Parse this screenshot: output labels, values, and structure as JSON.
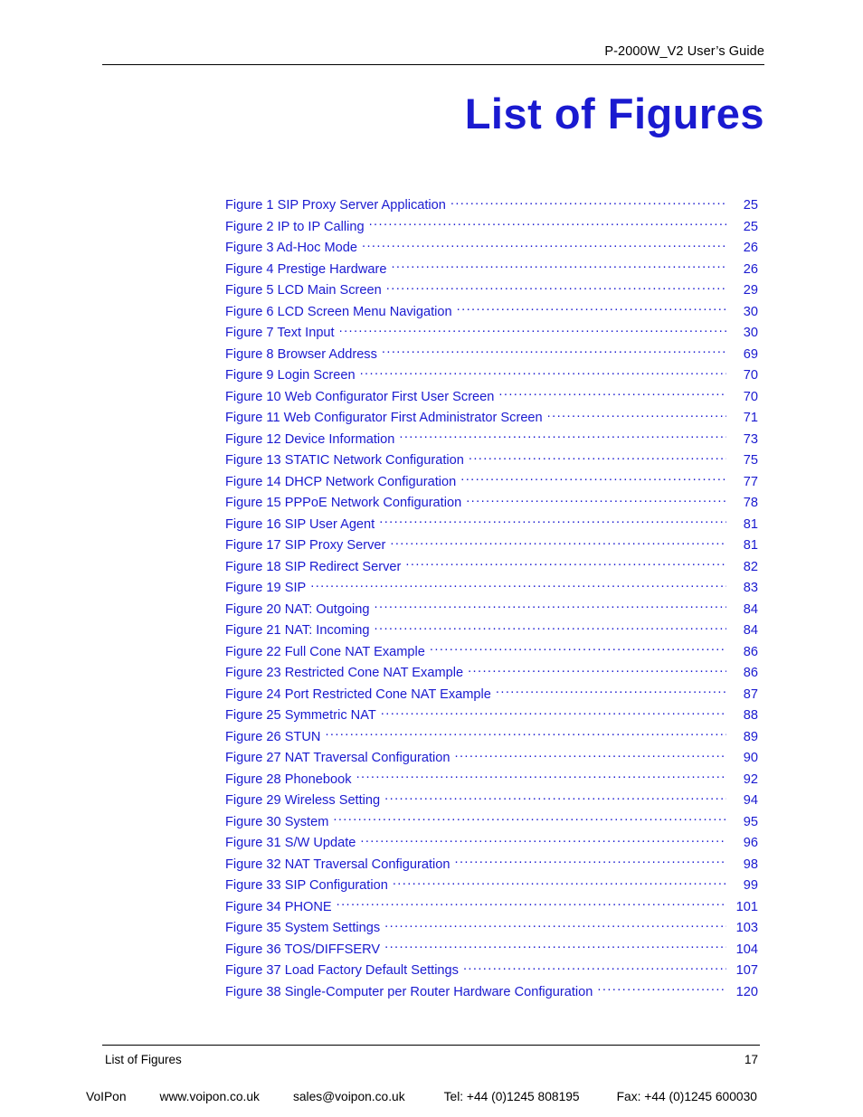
{
  "header": {
    "running_title": "P-2000W_V2 User’s Guide"
  },
  "title": "List of Figures",
  "colors": {
    "heading_blue": "#1a1ad0",
    "body_black": "#000000"
  },
  "list_of_figures": {
    "entries": [
      {
        "label": "Figure 1 SIP Proxy Server Application",
        "page": "25"
      },
      {
        "label": "Figure 2 IP to IP Calling",
        "page": "25"
      },
      {
        "label": "Figure 3 Ad-Hoc Mode",
        "page": "26"
      },
      {
        "label": "Figure 4 Prestige Hardware",
        "page": "26"
      },
      {
        "label": "Figure 5 LCD Main Screen",
        "page": "29"
      },
      {
        "label": "Figure 6 LCD Screen Menu Navigation",
        "page": "30"
      },
      {
        "label": "Figure 7 Text Input",
        "page": "30"
      },
      {
        "label": "Figure 8 Browser Address",
        "page": "69"
      },
      {
        "label": "Figure 9 Login Screen",
        "page": "70"
      },
      {
        "label": "Figure 10 Web Configurator First User Screen",
        "page": "70"
      },
      {
        "label": "Figure 11 Web Configurator First Administrator Screen",
        "page": "71"
      },
      {
        "label": "Figure 12 Device Information",
        "page": "73"
      },
      {
        "label": "Figure 13 STATIC Network Configuration",
        "page": "75"
      },
      {
        "label": "Figure 14 DHCP Network Configuration",
        "page": "77"
      },
      {
        "label": "Figure 15 PPPoE Network Configuration",
        "page": "78"
      },
      {
        "label": "Figure 16 SIP User Agent",
        "page": "81"
      },
      {
        "label": "Figure 17 SIP Proxy Server",
        "page": "81"
      },
      {
        "label": "Figure 18 SIP Redirect Server",
        "page": "82"
      },
      {
        "label": "Figure 19 SIP",
        "page": "83"
      },
      {
        "label": "Figure 20 NAT: Outgoing",
        "page": "84"
      },
      {
        "label": "Figure 21 NAT: Incoming",
        "page": "84"
      },
      {
        "label": "Figure 22 Full Cone NAT Example",
        "page": "86"
      },
      {
        "label": "Figure 23 Restricted Cone NAT Example",
        "page": "86"
      },
      {
        "label": "Figure 24 Port Restricted Cone NAT Example",
        "page": "87"
      },
      {
        "label": "Figure 25 Symmetric NAT",
        "page": "88"
      },
      {
        "label": "Figure 26 STUN",
        "page": "89"
      },
      {
        "label": "Figure 27 NAT Traversal Configuration",
        "page": "90"
      },
      {
        "label": "Figure 28 Phonebook",
        "page": "92"
      },
      {
        "label": "Figure 29 Wireless Setting",
        "page": "94"
      },
      {
        "label": "Figure 30 System",
        "page": "95"
      },
      {
        "label": "Figure 31 S/W Update",
        "page": "96"
      },
      {
        "label": "Figure 32 NAT Traversal Configuration",
        "page": "98"
      },
      {
        "label": "Figure 33 SIP Configuration",
        "page": "99"
      },
      {
        "label": "Figure 34 PHONE",
        "page": "101"
      },
      {
        "label": "Figure 35 System Settings",
        "page": "103"
      },
      {
        "label": "Figure 36 TOS/DIFFSERV",
        "page": "104"
      },
      {
        "label": "Figure 37 Load Factory Default Settings",
        "page": "107"
      },
      {
        "label": "Figure 38 Single-Computer per Router Hardware Configuration",
        "page": "120"
      }
    ]
  },
  "footer": {
    "section_name": "List of Figures",
    "page_number": "17"
  },
  "voipon_bar": {
    "brand": "VoIPon",
    "website": "www.voipon.co.uk",
    "email": "sales@voipon.co.uk",
    "telephone": "Tel: +44 (0)1245 808195",
    "fax": "Fax: +44 (0)1245 600030"
  }
}
